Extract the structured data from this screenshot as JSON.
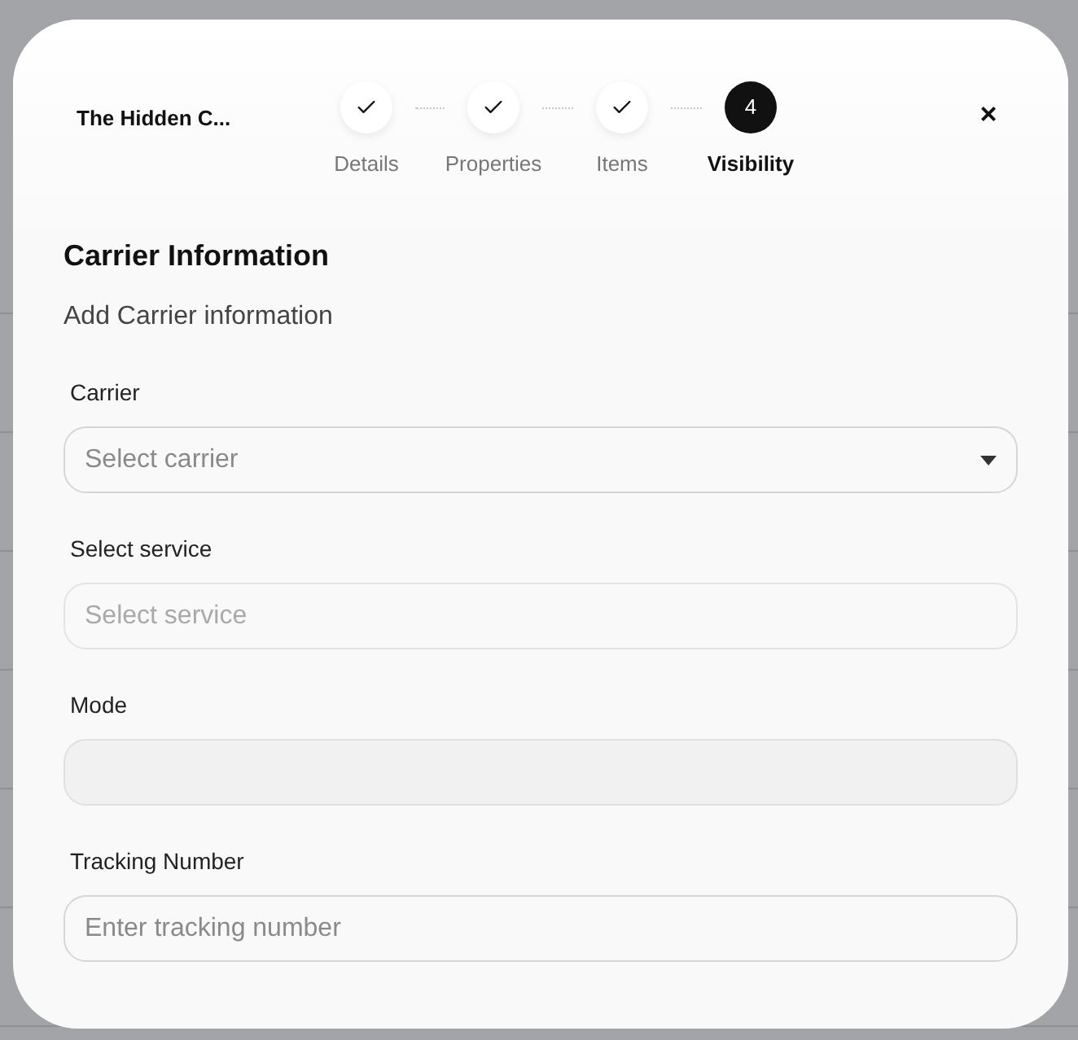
{
  "dialog": {
    "title": "The Hidden C..."
  },
  "steps": [
    {
      "label": "Details",
      "completed": true,
      "selected": false
    },
    {
      "label": "Properties",
      "completed": true,
      "selected": false
    },
    {
      "label": "Items",
      "completed": true,
      "selected": false
    },
    {
      "label": "Visibility",
      "number": "4",
      "completed": false,
      "selected": true
    }
  ],
  "close": {
    "glyph": "×"
  },
  "section": {
    "title": "Carrier Information",
    "subtitle": "Add Carrier information"
  },
  "fields": [
    {
      "kind": "select",
      "label": "Carrier",
      "placeholder": "Select carrier",
      "disabled": false
    },
    {
      "kind": "text",
      "label": "Select service",
      "placeholder": "Select service",
      "disabled": true
    },
    {
      "kind": "blank",
      "label": "Mode"
    },
    {
      "kind": "text",
      "label": "Tracking Number",
      "placeholder": "Enter tracking number",
      "disabled": false
    }
  ]
}
